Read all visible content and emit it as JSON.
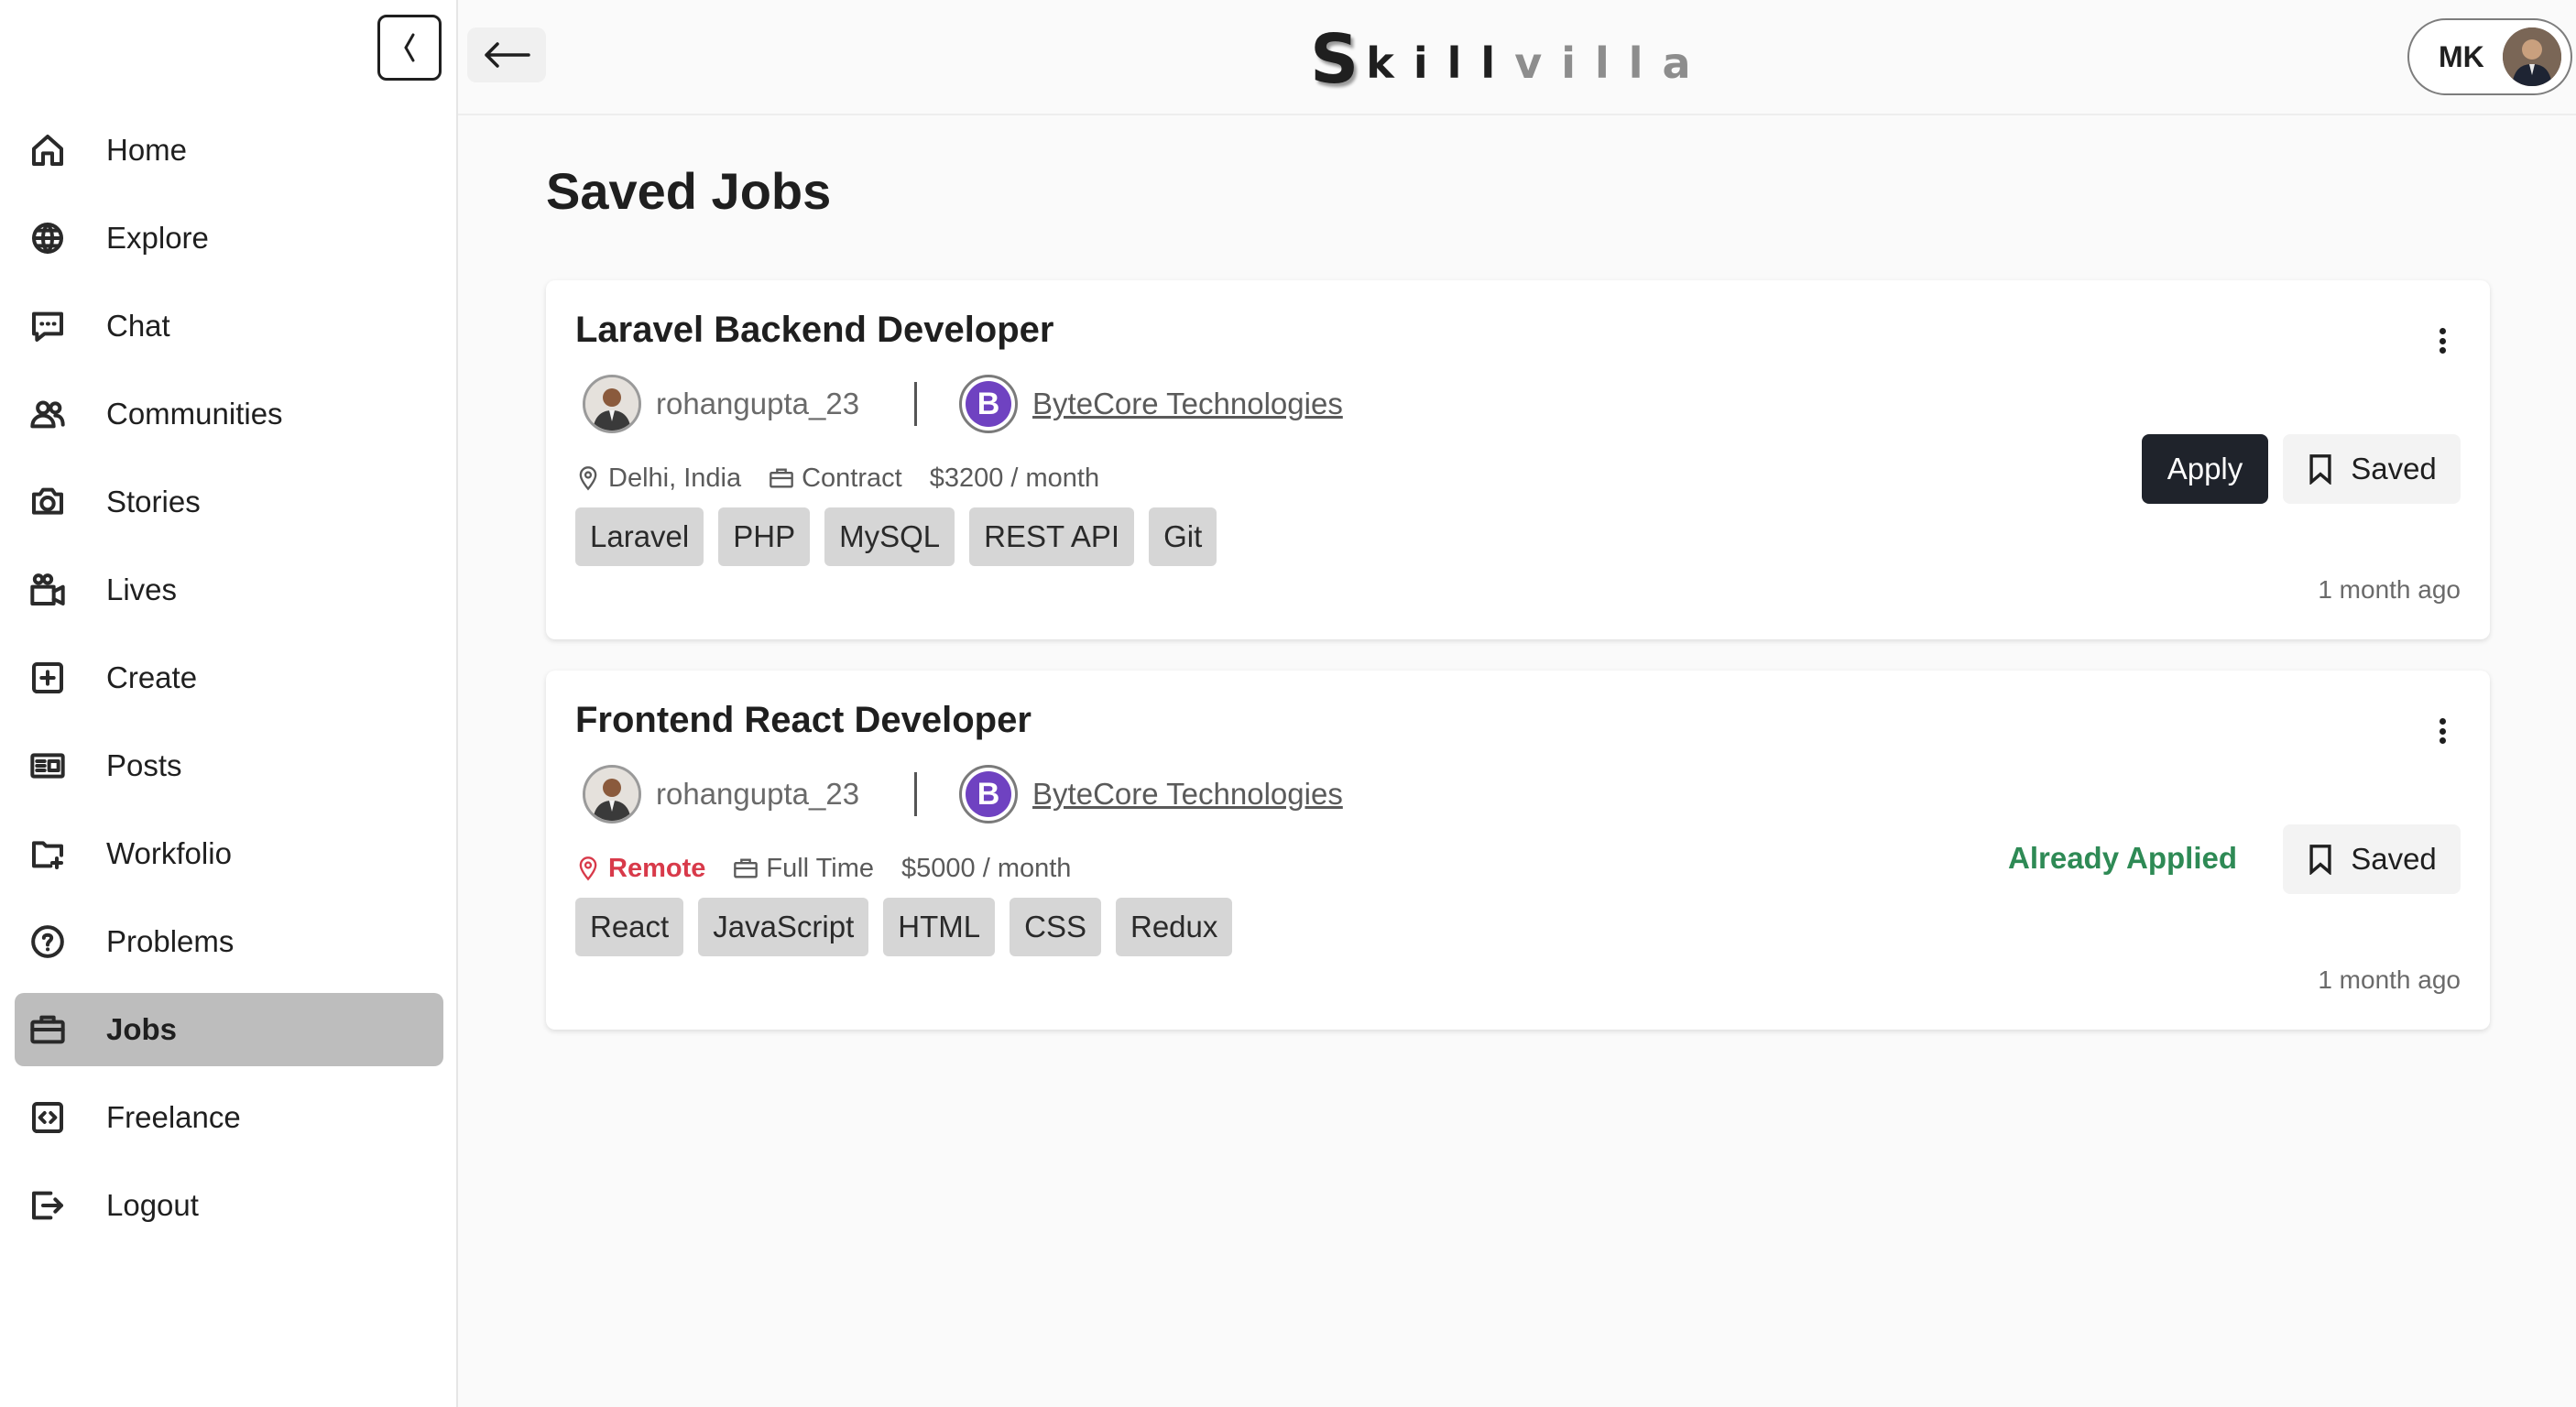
{
  "brand": {
    "logo_first": "S",
    "logo_dark": "kill",
    "logo_light": "villa"
  },
  "user": {
    "initials": "MK"
  },
  "sidebar": {
    "items": [
      {
        "label": "Home",
        "icon": "home-icon"
      },
      {
        "label": "Explore",
        "icon": "globe-icon"
      },
      {
        "label": "Chat",
        "icon": "chat-icon"
      },
      {
        "label": "Communities",
        "icon": "users-icon"
      },
      {
        "label": "Stories",
        "icon": "camera-icon"
      },
      {
        "label": "Lives",
        "icon": "video-icon"
      },
      {
        "label": "Create",
        "icon": "plus-square-icon"
      },
      {
        "label": "Posts",
        "icon": "newspaper-icon"
      },
      {
        "label": "Workfolio",
        "icon": "folder-plus-icon"
      },
      {
        "label": "Problems",
        "icon": "question-circle-icon"
      },
      {
        "label": "Jobs",
        "icon": "briefcase-icon",
        "active": true
      },
      {
        "label": "Freelance",
        "icon": "code-square-icon"
      },
      {
        "label": "Logout",
        "icon": "logout-icon"
      }
    ]
  },
  "main": {
    "title": "Saved Jobs",
    "jobs": [
      {
        "title": "Laravel Backend Developer",
        "poster": "rohangupta_23",
        "company": "ByteCore Technologies",
        "company_initial": "B",
        "location": "Delhi, India",
        "type": "Contract",
        "salary": "$3200 / month",
        "tags": [
          "Laravel",
          "PHP",
          "MySQL",
          "REST API",
          "Git"
        ],
        "apply_label": "Apply",
        "saved_label": "Saved",
        "posted": "1 month ago"
      },
      {
        "title": "Frontend React Developer",
        "poster": "rohangupta_23",
        "company": "ByteCore Technologies",
        "company_initial": "B",
        "location": "Remote",
        "type": "Full Time",
        "salary": "$5000 / month",
        "tags": [
          "React",
          "JavaScript",
          "HTML",
          "CSS",
          "Redux"
        ],
        "status_label": "Already Applied",
        "saved_label": "Saved",
        "posted": "1 month ago"
      }
    ]
  },
  "colors": {
    "active_nav": "#bdbdbd",
    "apply_button": "#1f232b",
    "applied_text": "#2e8a55",
    "remote_text": "#d83a4a",
    "company_badge": "#6f42c1"
  }
}
